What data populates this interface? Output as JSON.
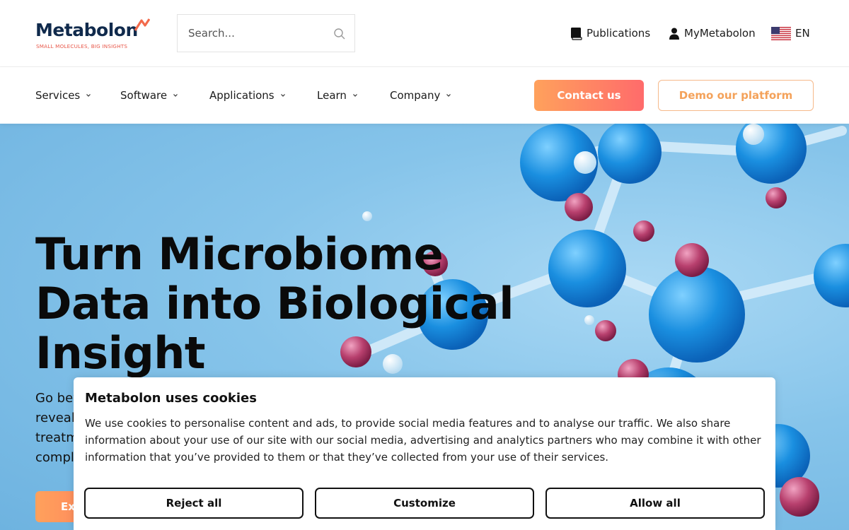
{
  "header": {
    "logo_text": "Metabolon",
    "logo_tagline": "SMALL MOLECULES, BIG INSIGHTS",
    "search": {
      "placeholder": "Search..."
    },
    "utility": {
      "publications": "Publications",
      "my_account": "MyMetabolon",
      "language": "EN"
    }
  },
  "nav": {
    "items": [
      {
        "label": "Services"
      },
      {
        "label": "Software"
      },
      {
        "label": "Applications"
      },
      {
        "label": "Learn"
      },
      {
        "label": "Company"
      }
    ],
    "contact_label": "Contact us",
    "demo_label": "Demo our platform"
  },
  "hero": {
    "title_lines": [
      "Turn Microbiome",
      "Data into Biological",
      "Insight"
    ],
    "text_fragments": [
      "Go bey",
      "reveal",
      "treatm",
      "compl"
    ],
    "button_fragment": "Ex"
  },
  "cookie": {
    "title": "Metabolon uses cookies",
    "body": "We use cookies to personalise content and ads, to provide social media features and to analyse our traffic. We also share information about your use of our site with our social media, advertising and analytics partners who may combine it with other information that you’ve provided to them or that they’ve collected from your use of their services.",
    "reject_label": "Reject all",
    "customize_label": "Customize",
    "allow_label": "Allow all"
  },
  "colors": {
    "brand_navy": "#102a4c",
    "accent_orange": "#ffa15c",
    "accent_coral": "#ff6b6b",
    "hero_blue": "#86c4ea"
  },
  "icons": {
    "search": "search-icon",
    "publications": "book-icon",
    "account": "user-icon",
    "language": "us-flag-icon",
    "nav_dropdown": "chevron-down-icon"
  }
}
